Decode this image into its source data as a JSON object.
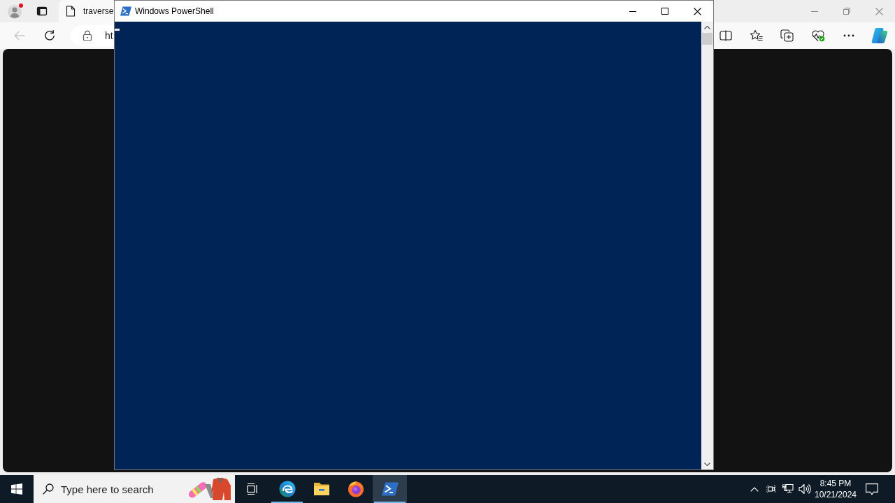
{
  "browser": {
    "tabs": [
      {
        "title": "traverse",
        "selected": true
      }
    ],
    "back_button": {
      "disabled": true
    },
    "address_bar": {
      "url": "ht"
    }
  },
  "powershell": {
    "title": "Windows PowerShell"
  },
  "taskbar": {
    "search": {
      "placeholder": "Type here to search"
    },
    "apps": [
      {
        "kind": "edge",
        "open": true,
        "selected": false
      },
      {
        "kind": "explorer",
        "open": false,
        "selected": false
      },
      {
        "kind": "firefox",
        "open": false,
        "selected": false
      },
      {
        "kind": "powershell",
        "open": true,
        "selected": true
      }
    ],
    "clock": {
      "time": "8:45 PM",
      "date": "10/21/2024"
    }
  }
}
